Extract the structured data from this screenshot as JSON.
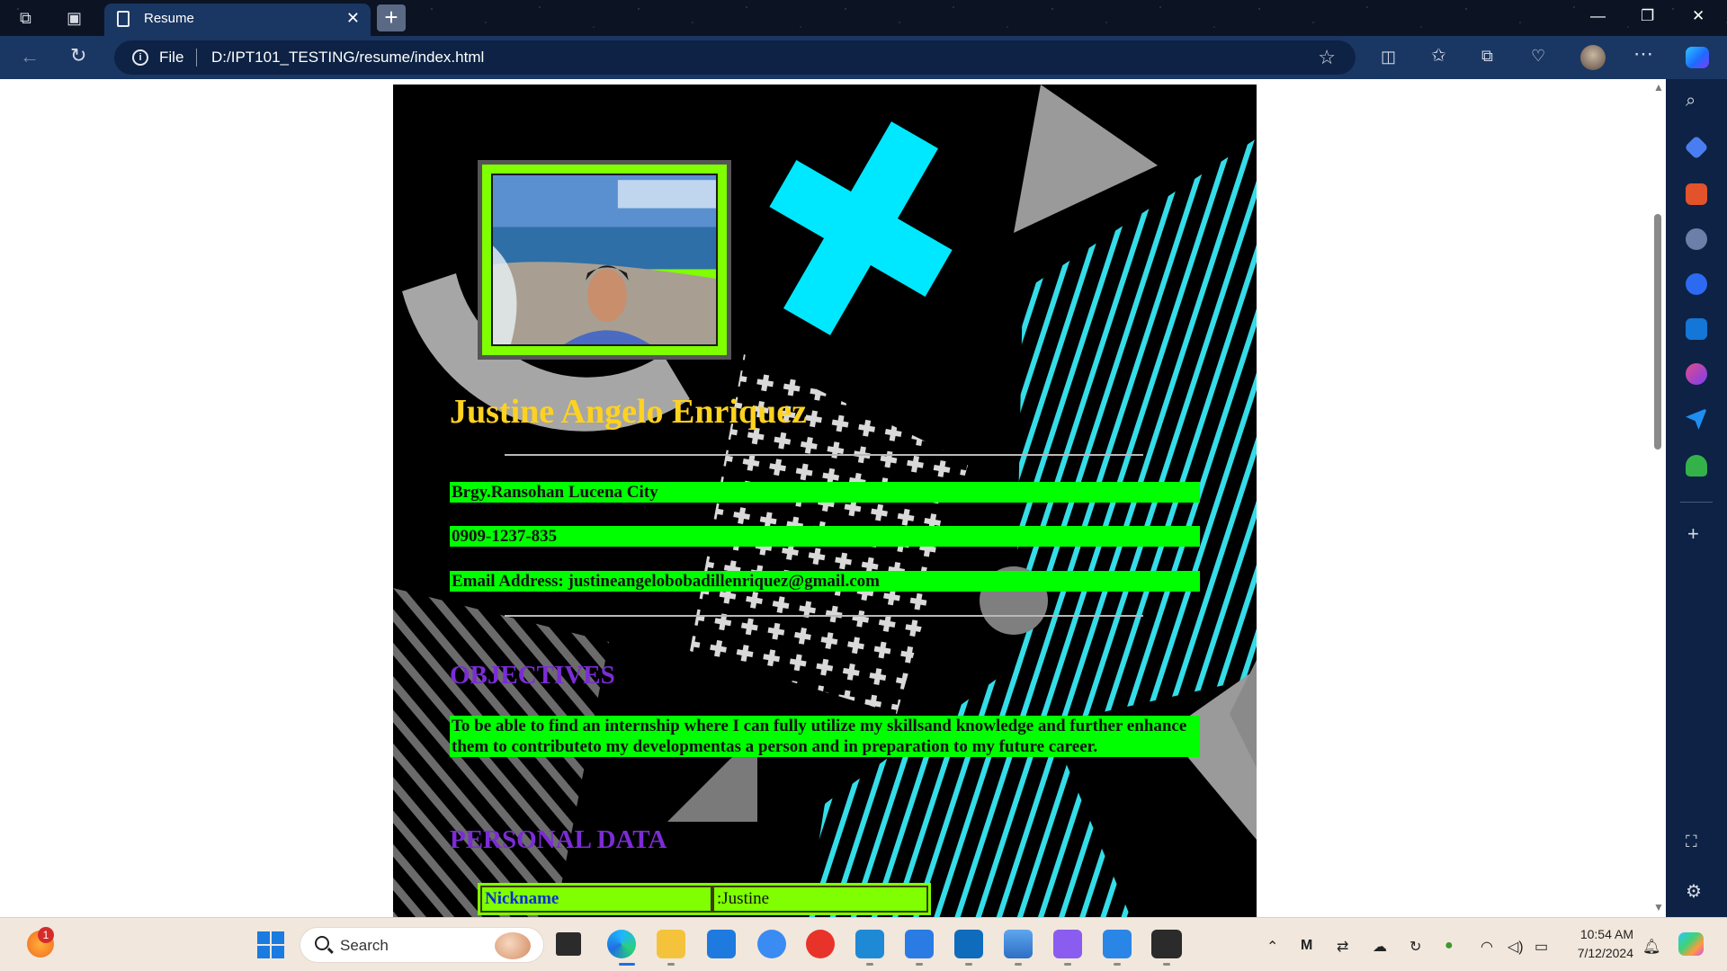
{
  "browser": {
    "tab_title": "Resume",
    "tab_close": "✕",
    "new_tab": "+",
    "file_label": "File",
    "url": "D:/IPT101_TESTING/resume/index.html",
    "window_controls": {
      "minimize": "—",
      "restore": "❐",
      "close": "✕"
    }
  },
  "resume": {
    "name": "Justine Angelo Enriquez",
    "address": "Brgy.Ransohan Lucena City",
    "phone": "0909-1237-835",
    "email": "Email Address: justineangelobobadillenriquez@gmail.com",
    "objectives_title": "OBJECTIVES",
    "objective_text": "To be able to find an internship where I can fully utilize my skillsand knowledge and further enhance them to contributeto my developmentas a person and in preparation to my future career.",
    "personal_data_title": "PERSONAL DATA",
    "personal_data": [
      {
        "label": "Nickname",
        "value": ":Justine"
      }
    ]
  },
  "taskbar": {
    "search_label": "Search",
    "notification_badge": "1",
    "time": "10:54 AM",
    "date": "7/12/2024"
  },
  "colors": {
    "name": "#ffd21f",
    "section_title": "#7b2cd6",
    "contact_bar": "#00ff00",
    "photo_frame": "#7fff00",
    "table_label": "#0c2fd4",
    "browser_bar": "#1a3763"
  }
}
